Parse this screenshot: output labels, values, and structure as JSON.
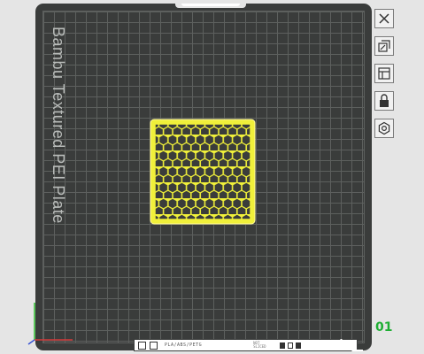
{
  "plate": {
    "name": "Bambu Textured PEI Plate",
    "index": "01"
  },
  "toolbar": {
    "items": [
      {
        "name": "close",
        "icon": "close-icon"
      },
      {
        "name": "auto-orient",
        "icon": "orient-icon"
      },
      {
        "name": "arrange",
        "icon": "arrange-icon"
      },
      {
        "name": "lock",
        "icon": "lock-icon"
      },
      {
        "name": "settings",
        "icon": "gear-icon"
      }
    ]
  },
  "bottom_bar": {
    "filament": "PLA/ABS/PETG",
    "status": "NOT SLICED"
  },
  "colors": {
    "model": "#f0f03a",
    "plate": "#3a3c3b",
    "grid": "#5d605e",
    "index": "#1fae34"
  }
}
